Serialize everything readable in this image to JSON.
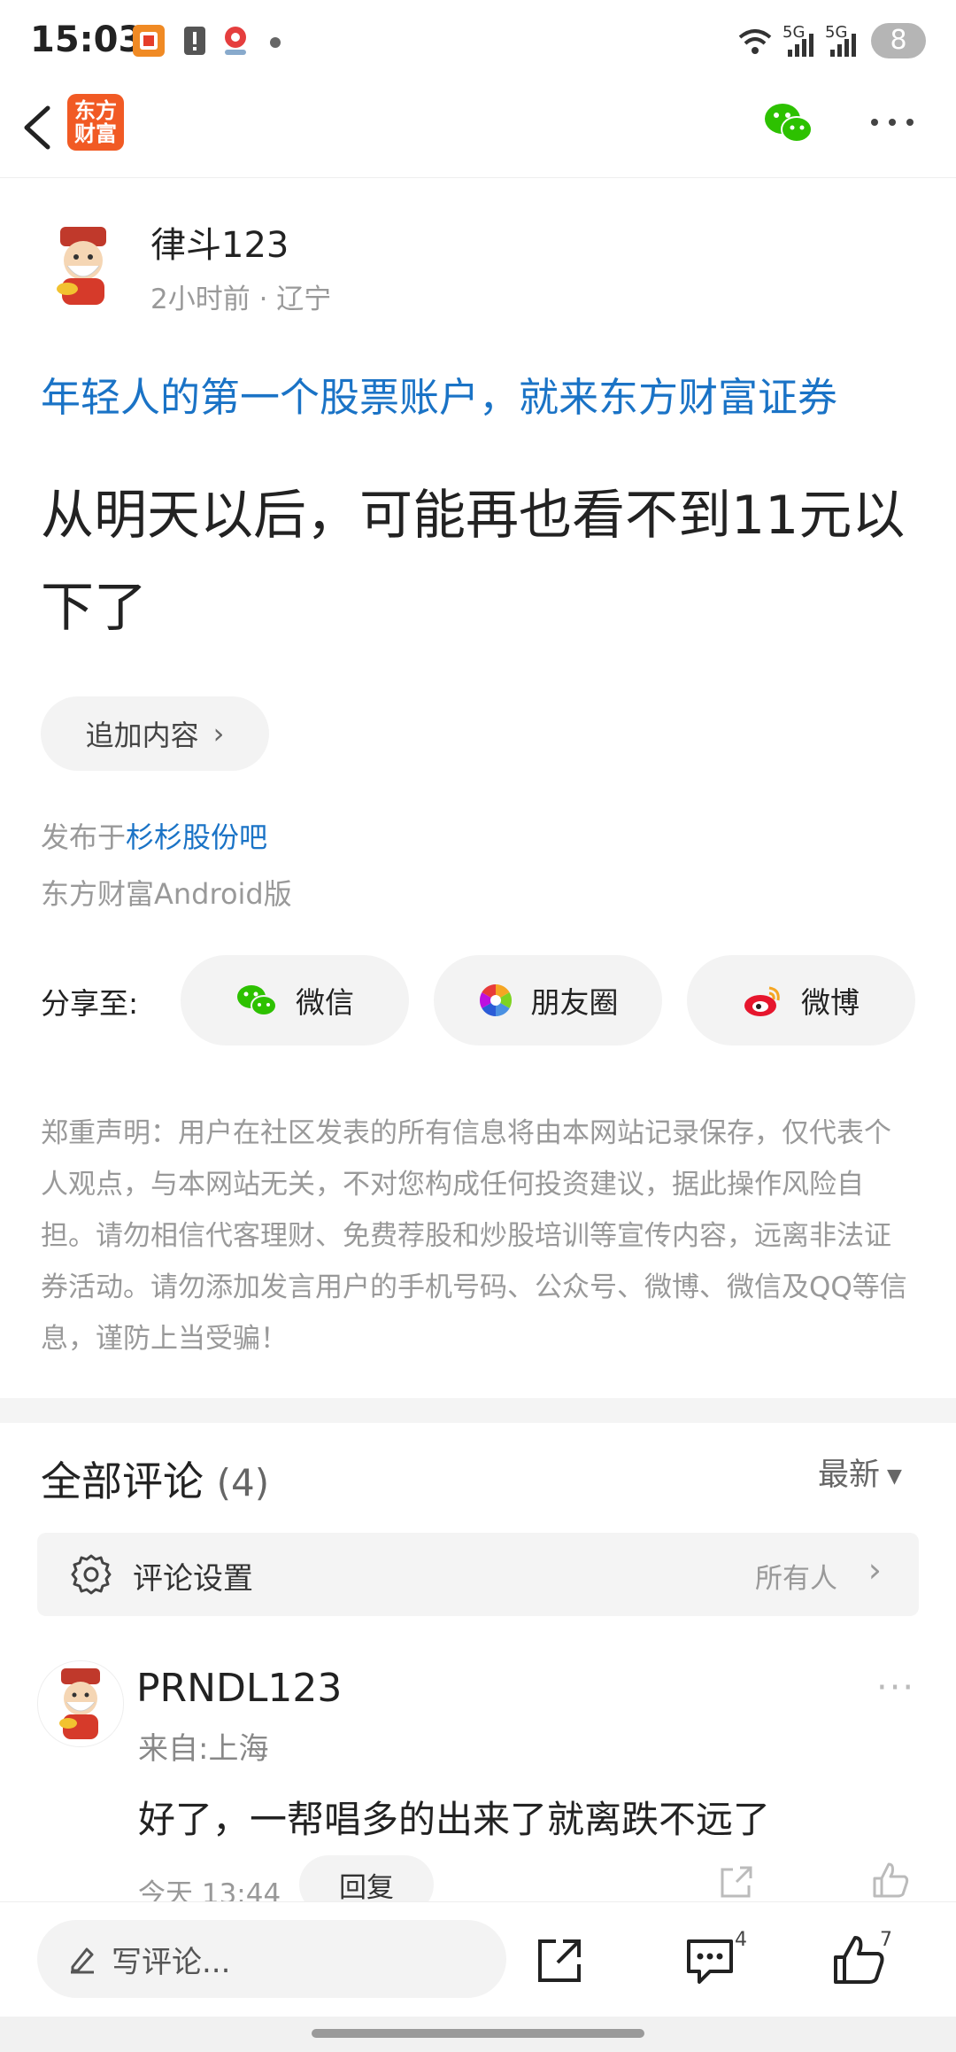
{
  "status_bar": {
    "time": "15:03",
    "network_1": "5G",
    "network_2": "5G",
    "battery": "8"
  },
  "nav": {
    "logo_text": "东方财富",
    "icons": [
      "back-arrow-icon",
      "wechat-icon",
      "more-icon"
    ]
  },
  "post": {
    "author": "律斗123",
    "meta": "2小时前 · 辽宁",
    "ad_line": "年轻人的第一个股票账户，就来东方财富证券",
    "title": "从明天以后，可能再也看不到11元以下了",
    "add_content_label": "追加内容",
    "published_prefix": "发布于",
    "published_board": "杉杉股份吧",
    "version": "东方财富Android版"
  },
  "share": {
    "label": "分享至:",
    "buttons": [
      {
        "label": "微信",
        "icon": "wechat-icon"
      },
      {
        "label": "朋友圈",
        "icon": "moments-icon"
      },
      {
        "label": "微博",
        "icon": "weibo-icon"
      }
    ]
  },
  "disclaimer": "郑重声明：用户在社区发表的所有信息将由本网站记录保存，仅代表个人观点，与本网站无关，不对您构成任何投资建议，据此操作风险自担。请勿相信代客理财、免费荐股和炒股培训等宣传内容，远离非法证券活动。请勿添加发言用户的手机号码、公众号、微博、微信及QQ等信息，谨防上当受骗！",
  "comments": {
    "title": "全部评论",
    "count": "(4)",
    "sort": "最新",
    "settings_label": "评论设置",
    "settings_value": "所有人",
    "items": [
      {
        "user": "PRNDL123",
        "from": "来自:上海",
        "text": "好了，一帮唱多的出来了就离跌不远了",
        "time": "今天 13:44",
        "reply_label": "回复"
      }
    ]
  },
  "bottom_bar": {
    "write_placeholder": "写评论...",
    "comment_count": "4",
    "like_count": "7"
  },
  "colors": {
    "accent_blue": "#1a73c6",
    "brand_orange": "#f15a24",
    "wechat_green": "#2dc100"
  }
}
